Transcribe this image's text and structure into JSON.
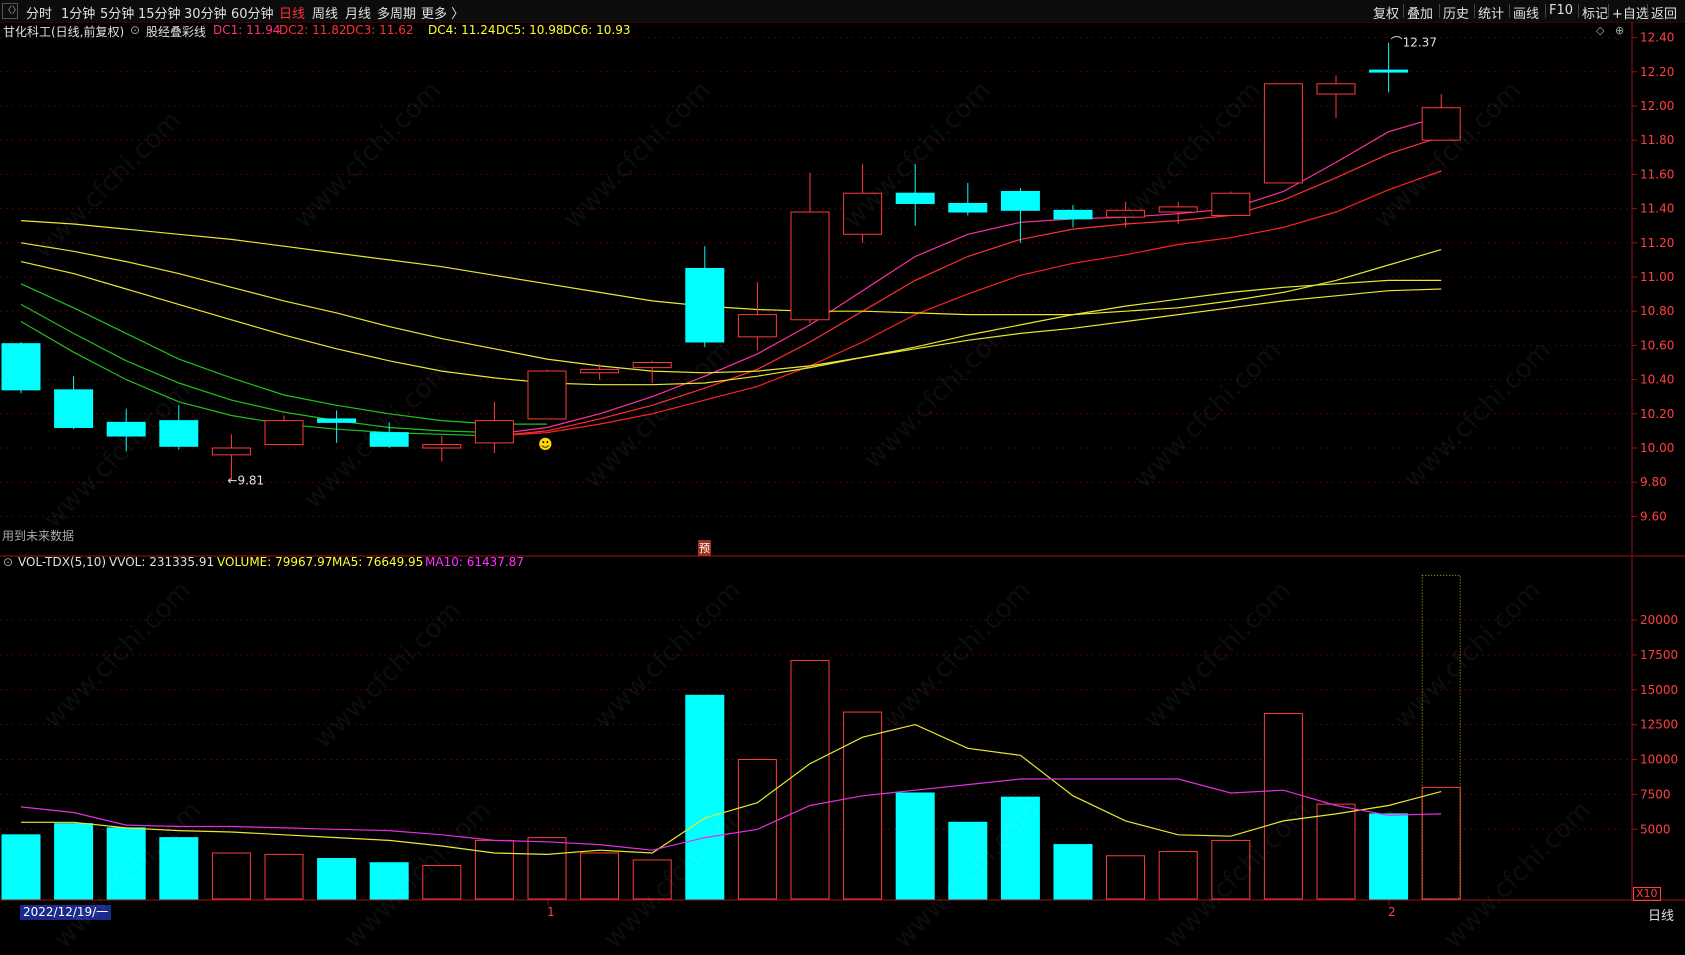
{
  "toolbar": {
    "periods": [
      "分时",
      "1分钟",
      "5分钟",
      "15分钟",
      "30分钟",
      "60分钟",
      "日线",
      "周线",
      "月线",
      "多周期",
      "更多 〉"
    ],
    "active_period": "日线",
    "right_buttons": [
      "复权",
      "叠加",
      "历史",
      "统计",
      "画线",
      "F10",
      "标记",
      "+自选",
      "返回"
    ]
  },
  "main_panel": {
    "stock_title": "甘化科工(日线,前复权)",
    "indicator_name": "股经叠彩线",
    "dc_values": [
      {
        "label": "DC1: 11.94",
        "color": "#ff3080"
      },
      {
        "label": "DC2: 11.82",
        "color": "#ff3030"
      },
      {
        "label": "DC3: 11.62",
        "color": "#ff3030"
      },
      {
        "label": "DC4: 11.24",
        "color": "#ffff30"
      },
      {
        "label": "DC5: 10.98",
        "color": "#ffff30"
      },
      {
        "label": "DC6: 10.93",
        "color": "#ffff30"
      }
    ],
    "low_marker": "9.81",
    "high_marker": "12.37",
    "future_data_note": "用到未来数据",
    "forecast_tag": "预"
  },
  "volume_panel": {
    "indicator_name": "VOL-TDX(5,10)",
    "vvol": "VVOL: 231335.91",
    "volume": "VOLUME: 79967.97",
    "ma5": "MA5: 76649.95",
    "ma10": "MA10: 61437.87",
    "multiplier": "X10"
  },
  "bottom_axis": {
    "start_date": "2022/12/19/一",
    "month_1": "1",
    "month_2": "2",
    "period_label": "日线"
  },
  "chart_data": [
    {
      "type": "candlestick",
      "y_ticks": [
        9.6,
        9.8,
        10.0,
        10.2,
        10.4,
        10.6,
        10.8,
        11.0,
        11.2,
        11.4,
        11.6,
        11.8,
        12.0,
        12.2,
        12.4
      ],
      "y_tick_labels": [
        "9.60",
        "9.80",
        "10.00",
        "10.20",
        "10.40",
        "10.60",
        "10.80",
        "11.00",
        "11.20",
        "11.40",
        "11.60",
        "11.80",
        "12.00",
        "12.20",
        "12.40"
      ],
      "ylim": [
        9.5,
        12.5
      ],
      "candles": [
        {
          "o": 10.61,
          "h": 10.62,
          "l": 10.32,
          "c": 10.34,
          "up": false
        },
        {
          "o": 10.34,
          "h": 10.42,
          "l": 10.11,
          "c": 10.12,
          "up": false
        },
        {
          "o": 10.15,
          "h": 10.23,
          "l": 9.98,
          "c": 10.07,
          "up": false
        },
        {
          "o": 10.16,
          "h": 10.25,
          "l": 9.99,
          "c": 10.01,
          "up": false
        },
        {
          "o": 9.96,
          "h": 10.08,
          "l": 9.81,
          "c": 10.0,
          "up": true
        },
        {
          "o": 10.02,
          "h": 10.19,
          "l": 10.02,
          "c": 10.16,
          "up": true
        },
        {
          "o": 10.17,
          "h": 10.22,
          "l": 10.03,
          "c": 10.15,
          "up": false
        },
        {
          "o": 10.09,
          "h": 10.15,
          "l": 10.0,
          "c": 10.01,
          "up": false
        },
        {
          "o": 10.0,
          "h": 10.07,
          "l": 9.92,
          "c": 10.02,
          "up": true
        },
        {
          "o": 10.03,
          "h": 10.27,
          "l": 9.97,
          "c": 10.16,
          "up": true
        },
        {
          "o": 10.17,
          "h": 10.46,
          "l": 10.17,
          "c": 10.45,
          "up": true
        },
        {
          "o": 10.44,
          "h": 10.49,
          "l": 10.4,
          "c": 10.46,
          "up": true
        },
        {
          "o": 10.47,
          "h": 10.51,
          "l": 10.38,
          "c": 10.5,
          "up": true
        },
        {
          "o": 11.05,
          "h": 11.18,
          "l": 10.59,
          "c": 10.62,
          "up": false
        },
        {
          "o": 10.65,
          "h": 10.97,
          "l": 10.57,
          "c": 10.78,
          "up": true
        },
        {
          "o": 10.75,
          "h": 11.61,
          "l": 10.73,
          "c": 11.38,
          "up": true
        },
        {
          "o": 11.25,
          "h": 11.66,
          "l": 11.2,
          "c": 11.49,
          "up": true
        },
        {
          "o": 11.49,
          "h": 11.66,
          "l": 11.3,
          "c": 11.43,
          "up": false
        },
        {
          "o": 11.43,
          "h": 11.55,
          "l": 11.36,
          "c": 11.38,
          "up": false
        },
        {
          "o": 11.5,
          "h": 11.52,
          "l": 11.2,
          "c": 11.39,
          "up": false
        },
        {
          "o": 11.39,
          "h": 11.42,
          "l": 11.29,
          "c": 11.34,
          "up": false
        },
        {
          "o": 11.35,
          "h": 11.44,
          "l": 11.29,
          "c": 11.39,
          "up": true
        },
        {
          "o": 11.38,
          "h": 11.44,
          "l": 11.31,
          "c": 11.41,
          "up": true
        },
        {
          "o": 11.36,
          "h": 11.5,
          "l": 11.36,
          "c": 11.49,
          "up": true
        },
        {
          "o": 11.55,
          "h": 12.13,
          "l": 11.55,
          "c": 12.13,
          "up": true
        },
        {
          "o": 12.07,
          "h": 12.18,
          "l": 11.93,
          "c": 12.13,
          "up": true
        },
        {
          "o": 12.21,
          "h": 12.37,
          "l": 12.08,
          "c": 12.2,
          "up": false
        },
        {
          "o": 11.8,
          "h": 12.07,
          "l": 11.8,
          "c": 11.99,
          "up": true
        }
      ],
      "lines": [
        {
          "name": "DC1",
          "color": "#ff30a0",
          "values": [
            null,
            null,
            null,
            null,
            null,
            null,
            null,
            null,
            null,
            10.08,
            10.12,
            10.2,
            10.3,
            10.42,
            10.55,
            10.72,
            10.92,
            11.12,
            11.25,
            11.32,
            11.34,
            11.35,
            11.37,
            11.4,
            11.5,
            11.67,
            11.85,
            11.94
          ]
        },
        {
          "name": "DC2",
          "color": "#ff3030",
          "values": [
            null,
            null,
            null,
            null,
            null,
            null,
            null,
            null,
            null,
            10.07,
            10.1,
            10.17,
            10.25,
            10.35,
            10.46,
            10.62,
            10.8,
            10.98,
            11.12,
            11.22,
            11.28,
            11.31,
            11.33,
            11.36,
            11.45,
            11.58,
            11.72,
            11.82
          ]
        },
        {
          "name": "DC3",
          "color": "#ff2020",
          "values": [
            null,
            null,
            null,
            null,
            null,
            null,
            null,
            null,
            null,
            10.07,
            10.09,
            10.14,
            10.2,
            10.28,
            10.36,
            10.48,
            10.62,
            10.78,
            10.9,
            11.01,
            11.08,
            11.13,
            11.19,
            11.23,
            11.29,
            11.38,
            11.51,
            11.62
          ]
        },
        {
          "name": "DC4",
          "color": "#e8e830",
          "values": [
            11.33,
            11.31,
            11.28,
            11.25,
            11.22,
            11.18,
            11.14,
            11.1,
            11.06,
            11.01,
            10.96,
            10.91,
            10.86,
            10.83,
            10.81,
            10.8,
            10.8,
            10.79,
            10.78,
            10.78,
            10.78,
            10.8,
            10.82,
            10.86,
            10.91,
            10.98,
            11.07,
            11.16
          ]
        },
        {
          "name": "DC5",
          "color": "#e8e830",
          "values": [
            11.2,
            11.15,
            11.09,
            11.02,
            10.94,
            10.86,
            10.79,
            10.71,
            10.64,
            10.58,
            10.52,
            10.48,
            10.45,
            10.44,
            10.45,
            10.48,
            10.53,
            10.59,
            10.66,
            10.72,
            10.78,
            10.83,
            10.87,
            10.91,
            10.94,
            10.96,
            10.98,
            10.98
          ]
        },
        {
          "name": "DC6",
          "color": "#e8e830",
          "values": [
            11.09,
            11.02,
            10.93,
            10.84,
            10.75,
            10.66,
            10.58,
            10.51,
            10.45,
            10.41,
            10.38,
            10.37,
            10.37,
            10.38,
            10.42,
            10.47,
            10.53,
            10.58,
            10.63,
            10.67,
            10.7,
            10.74,
            10.78,
            10.82,
            10.86,
            10.89,
            10.92,
            10.93
          ]
        },
        {
          "name": "GREEN1",
          "color": "#20c020",
          "values": [
            10.96,
            10.82,
            10.67,
            10.52,
            10.41,
            10.31,
            10.25,
            10.2,
            10.16,
            10.14,
            10.14,
            null,
            null,
            null,
            null,
            null,
            null,
            null,
            null,
            null,
            null,
            null,
            null,
            null,
            null,
            null,
            null,
            null
          ]
        },
        {
          "name": "GREEN2",
          "color": "#20c020",
          "values": [
            10.84,
            10.67,
            10.51,
            10.38,
            10.28,
            10.21,
            10.16,
            10.12,
            10.1,
            10.09,
            null,
            null,
            null,
            null,
            null,
            null,
            null,
            null,
            null,
            null,
            null,
            null,
            null,
            null,
            null,
            null,
            null,
            null
          ]
        },
        {
          "name": "GREEN3",
          "color": "#20c020",
          "values": [
            10.74,
            10.56,
            10.4,
            10.27,
            10.19,
            10.14,
            10.11,
            10.09,
            10.08,
            10.07,
            null,
            null,
            null,
            null,
            null,
            null,
            null,
            null,
            null,
            null,
            null,
            null,
            null,
            null,
            null,
            null,
            null,
            null
          ]
        }
      ]
    },
    {
      "type": "bar",
      "y_ticks": [
        5000,
        7500,
        10000,
        12500,
        15000,
        17500,
        20000
      ],
      "y_tick_labels": [
        "5000",
        "7500",
        "10000",
        "12500",
        "15000",
        "17500",
        "20000"
      ],
      "ylim": [
        0,
        23000
      ],
      "volumes": [
        4600,
        5400,
        5100,
        4400,
        3300,
        3200,
        2900,
        2600,
        2400,
        4200,
        4400,
        3300,
        2800,
        14600,
        10000,
        17100,
        13400,
        7600,
        5500,
        7300,
        3900,
        3100,
        3400,
        4200,
        13300,
        6800,
        6100,
        8000
      ],
      "vol_up": [
        false,
        false,
        false,
        false,
        true,
        true,
        false,
        false,
        true,
        true,
        true,
        true,
        true,
        false,
        true,
        true,
        true,
        false,
        false,
        false,
        false,
        true,
        true,
        true,
        true,
        true,
        false,
        true
      ],
      "forecast_bar": 23200,
      "ma5": [
        5500,
        5500,
        5100,
        4900,
        4800,
        4600,
        4400,
        4200,
        3800,
        3300,
        3200,
        3500,
        3300,
        5800,
        6900,
        9700,
        11600,
        12500,
        10800,
        10300,
        7400,
        5600,
        4600,
        4500,
        5600,
        6100,
        6700,
        7700
      ],
      "ma10": [
        6600,
        6200,
        5300,
        5200,
        5200,
        5100,
        5000,
        4900,
        4600,
        4200,
        4100,
        3900,
        3500,
        4400,
        5000,
        6700,
        7400,
        7800,
        8200,
        8600,
        8600,
        8600,
        8600,
        7600,
        7800,
        6700,
        6000,
        6100
      ]
    }
  ]
}
